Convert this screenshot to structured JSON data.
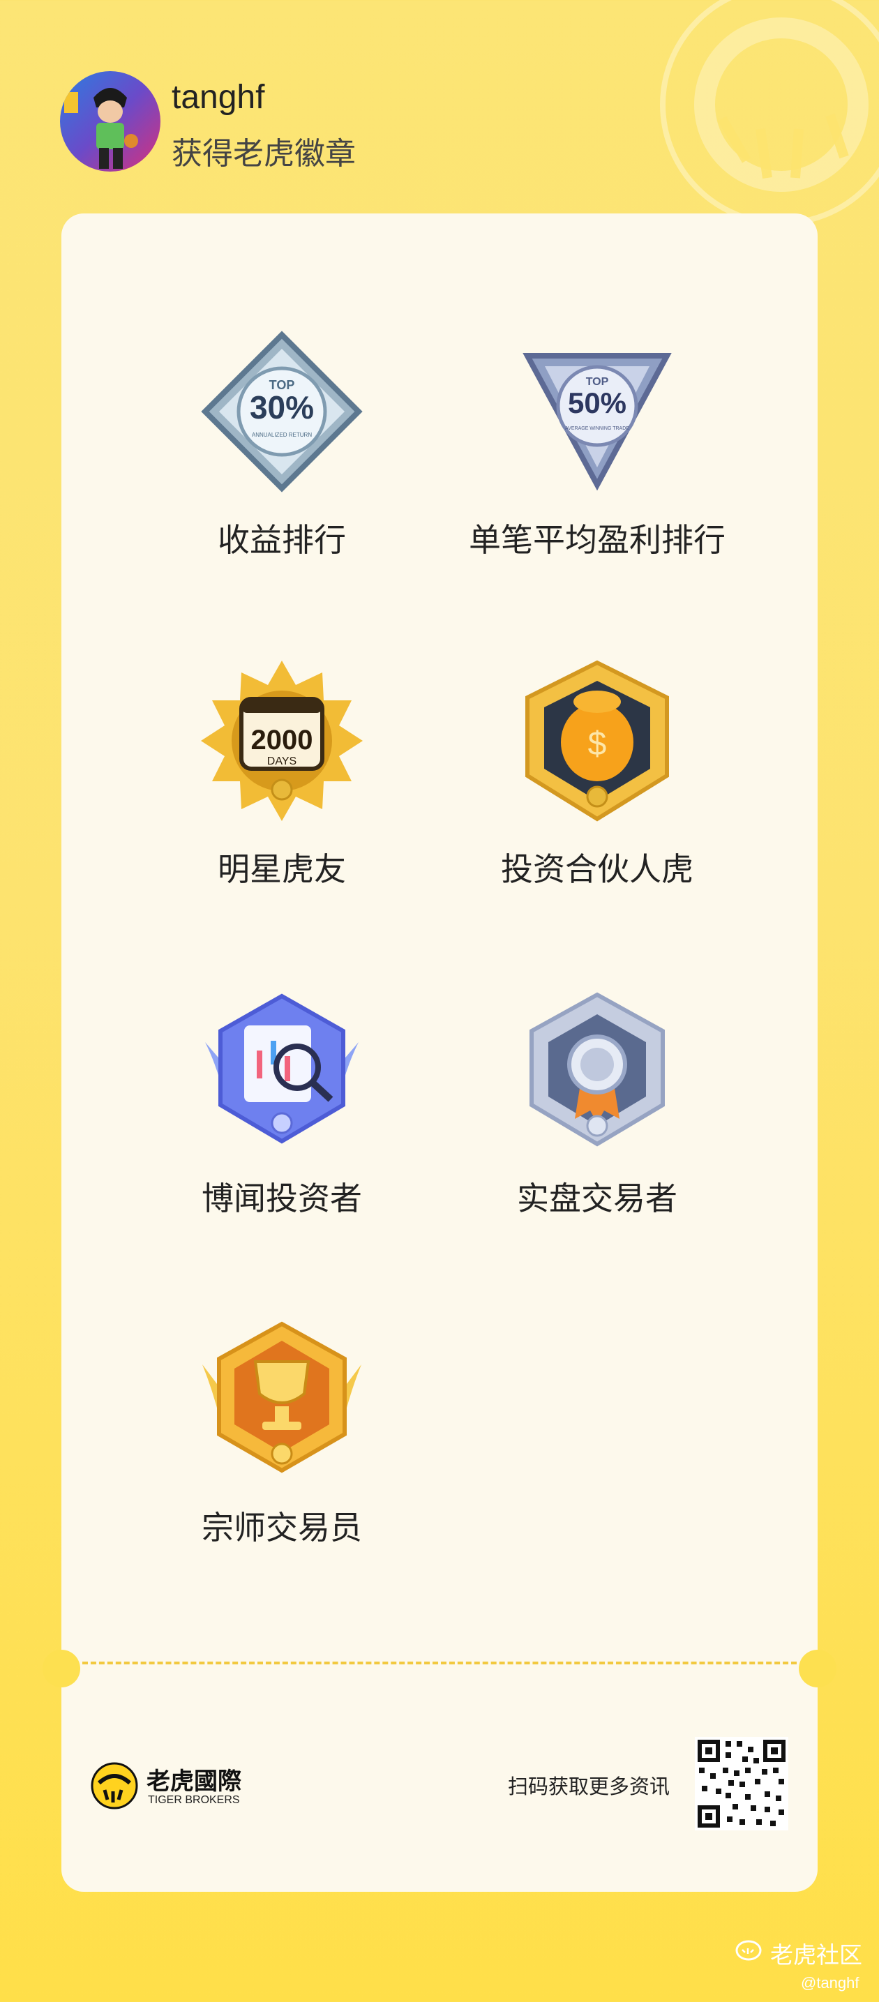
{
  "header": {
    "username": "tanghf",
    "subtitle": "获得老虎徽章"
  },
  "badges": [
    {
      "name": "收益排行",
      "icon": "top-30-percent-badge-icon",
      "badge_text": "30%",
      "badge_top": "TOP",
      "badge_caption": "ANNUALIZED RETURN"
    },
    {
      "name": "单笔平均盈利排行",
      "icon": "top-50-percent-badge-icon",
      "badge_text": "50%",
      "badge_top": "TOP",
      "badge_caption": "AVERAGE WINNING TRADE"
    },
    {
      "name": "明星虎友",
      "icon": "2000-days-badge-icon",
      "badge_text": "2000",
      "badge_caption": "DAYS"
    },
    {
      "name": "投资合伙人虎",
      "icon": "money-bag-tiger-badge-icon"
    },
    {
      "name": "博闻投资者",
      "icon": "magnifier-chart-badge-icon"
    },
    {
      "name": "实盘交易者",
      "icon": "silver-medal-badge-icon"
    },
    {
      "name": "宗师交易员",
      "icon": "gold-trophy-badge-icon"
    }
  ],
  "footer": {
    "logo_cn": "老虎國際",
    "logo_en": "TIGER BROKERS",
    "scan_text": "扫码获取更多资讯"
  },
  "community": {
    "label": "老虎社区",
    "watermark": "@tanghf"
  },
  "colors": {
    "background": "#fde36f",
    "card": "#fdf9ec",
    "dash": "#f2c93f",
    "text": "#222222"
  }
}
